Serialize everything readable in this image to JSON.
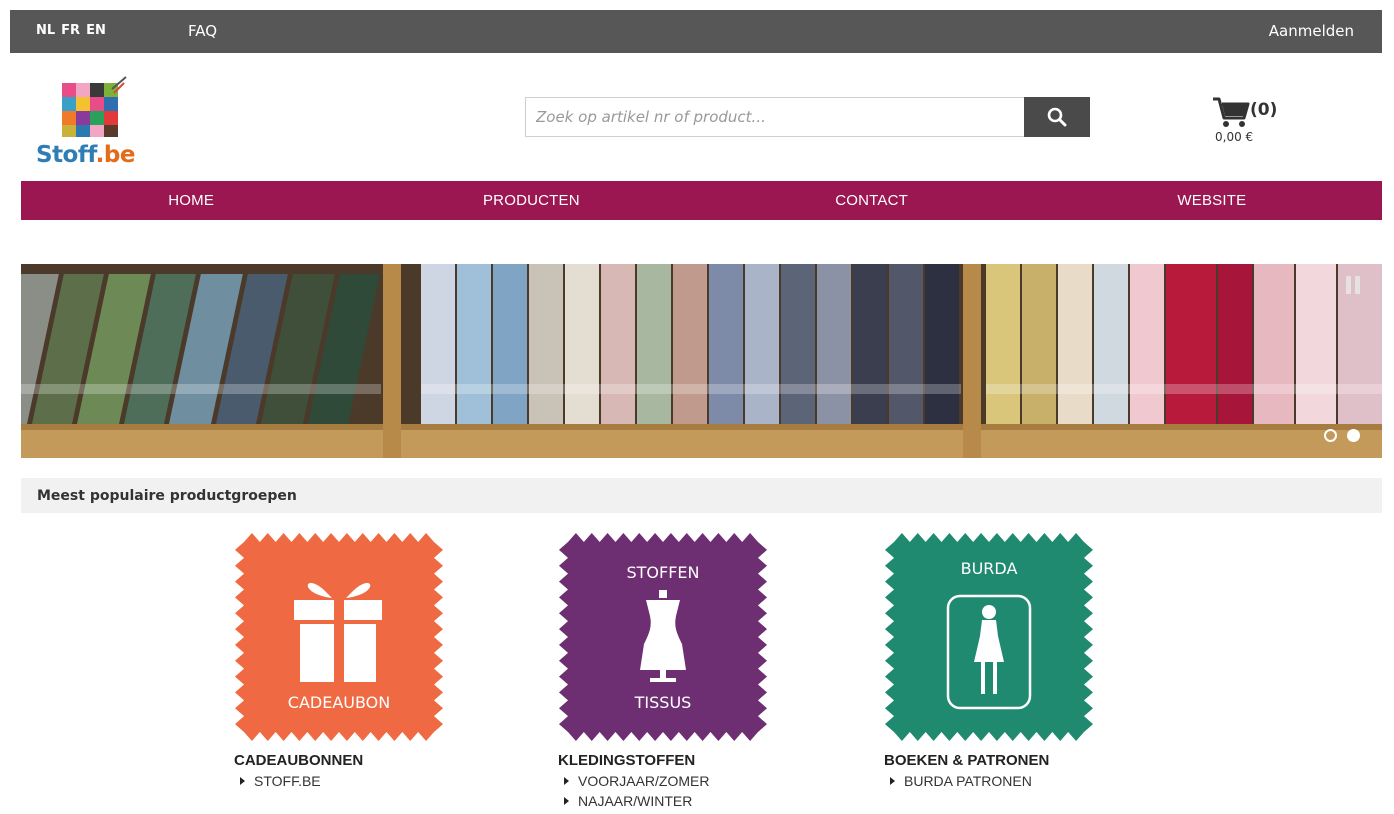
{
  "topbar": {
    "languages": [
      "NL",
      "FR",
      "EN"
    ],
    "faq": "FAQ",
    "login": "Aanmelden"
  },
  "logo": {
    "text_main": "Stoff",
    "text_dot": ".be"
  },
  "search": {
    "placeholder": "Zoek op artikel nr of product...",
    "button_icon": "search-icon"
  },
  "cart": {
    "count": "(0)",
    "total": "0,00 €",
    "icon": "cart-icon"
  },
  "nav": {
    "items": [
      "HOME",
      "PRODUCTEN",
      "CONTACT",
      "WEBSITE"
    ]
  },
  "banner": {
    "slides": 2,
    "active_slide": 2
  },
  "section": {
    "title": "Meest populaire productgroepen"
  },
  "categories": [
    {
      "title": "CADEAUBONNEN",
      "tile_label_bottom": "CADEAUBON",
      "tile_icon": "gift-icon",
      "tile_color": "#ef6a43",
      "links": [
        "STOFF.BE"
      ]
    },
    {
      "title": "KLEDINGSTOFFEN",
      "tile_label_top": "STOFFEN",
      "tile_label_bottom": "TISSUS",
      "tile_icon": "dress-form-icon",
      "tile_color": "#6d2e72",
      "links": [
        "VOORJAAR/ZOMER",
        "NAJAAR/WINTER"
      ]
    },
    {
      "title": "BOEKEN & PATRONEN",
      "tile_label_top": "BURDA",
      "tile_icon": "woman-silhouette-icon",
      "tile_color": "#1f8a70",
      "links": [
        "BURDA PATRONEN"
      ]
    }
  ],
  "colors": {
    "topbar": "#575757",
    "nav": "#9b1752",
    "search_button": "#4a4a4a"
  }
}
